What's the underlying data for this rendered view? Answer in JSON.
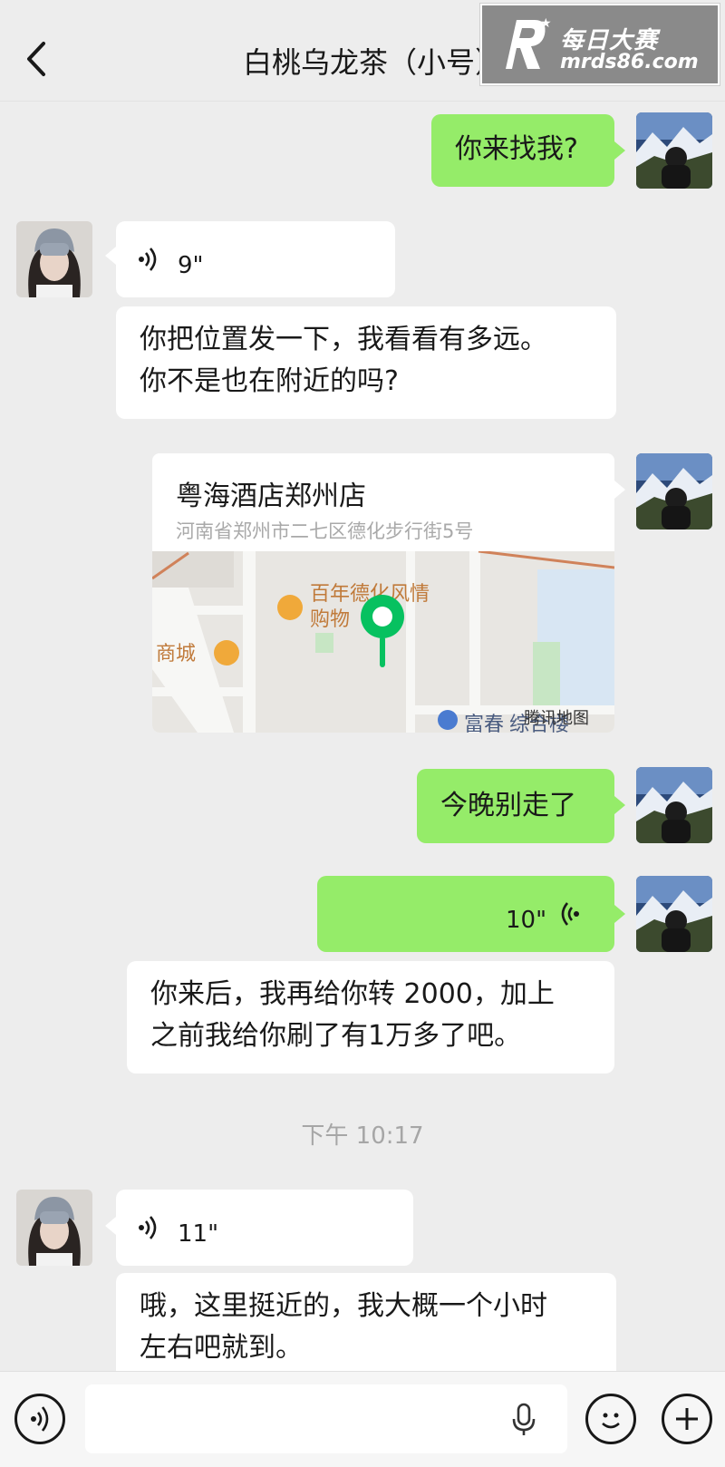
{
  "header": {
    "title": "白桃乌龙茶（小号）"
  },
  "watermark": {
    "brand": "每日大赛",
    "domain": "mrds86.com"
  },
  "messages": {
    "m1_text": "你来找我?",
    "m2_voice_duration": "9\"",
    "m3_line1": "你把位置发一下，我看看有多远。",
    "m3_line2": "你不是也在附近的吗?",
    "m4_location_name": "粤海酒店郑州店",
    "m4_location_address": "河南省郑州市二七区德化步行街5号",
    "m4_map_poi1_line1": "百年德化风情",
    "m4_map_poi1_line2": "购物",
    "m4_map_poi2": "商城",
    "m4_map_poi3": "富春",
    "m4_map_poi3_suffix": "综合楼",
    "m4_map_provider": "腾讯地图",
    "m5_text": "今晚别走了",
    "m6_voice_duration": "10\"",
    "m7_line1": "你来后，我再给你转 2000，加上",
    "m7_line2": "之前我给你刷了有1万多了吧。",
    "timestamp": "下午 10:17",
    "m8_voice_duration": "11\"",
    "m9_line1": "哦，这里挺近的，我大概一个小时",
    "m9_line2": "左右吧就到。"
  },
  "colors": {
    "background": "#ededed",
    "sent_bubble": "#95ec69",
    "received_bubble": "#ffffff",
    "map_pin": "#07c160"
  },
  "icons": {
    "back": "chevron-left-icon",
    "voice_input": "voice-icon",
    "mic": "mic-icon",
    "emoji": "emoji-icon",
    "more": "plus-icon"
  }
}
